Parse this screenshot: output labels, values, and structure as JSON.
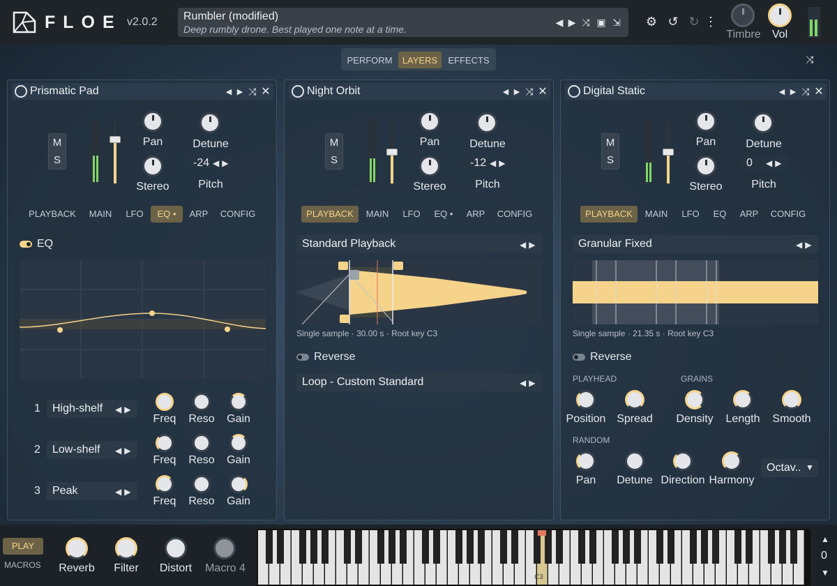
{
  "header": {
    "logo_text": "FLOE",
    "version": "v2.0.2",
    "preset_name": "Rumbler (modified)",
    "preset_description": "Deep rumbly drone. Best played one note at a time.",
    "timbre_label": "Timbre",
    "vol_label": "Vol"
  },
  "main_tabs": [
    {
      "label": "PERFORM"
    },
    {
      "label": "LAYERS"
    },
    {
      "label": "EFFECTS"
    }
  ],
  "layers": [
    {
      "name": "Prismatic Pad",
      "mute": "M",
      "solo": "S",
      "pan_label": "Pan",
      "stereo_label": "Stereo",
      "detune_label": "Detune",
      "pitch_label": "Pitch",
      "pitch_value": "-24",
      "level": 0.85,
      "sub_tabs": [
        "PLAYBACK",
        "MAIN",
        "LFO",
        "EQ •",
        "ARP",
        "CONFIG"
      ],
      "active_sub_tab": "EQ •"
    },
    {
      "name": "Night Orbit",
      "mute": "M",
      "solo": "S",
      "pan_label": "Pan",
      "stereo_label": "Stereo",
      "detune_label": "Detune",
      "pitch_label": "Pitch",
      "pitch_value": "-12",
      "level": 0.5,
      "sub_tabs": [
        "PLAYBACK",
        "MAIN",
        "LFO",
        "EQ •",
        "ARP",
        "CONFIG"
      ],
      "active_sub_tab": "PLAYBACK"
    },
    {
      "name": "Digital Static",
      "mute": "M",
      "solo": "S",
      "pan_label": "Pan",
      "stereo_label": "Stereo",
      "detune_label": "Detune",
      "pitch_label": "Pitch",
      "pitch_value": "0",
      "level": 0.5,
      "sub_tabs": [
        "PLAYBACK",
        "MAIN",
        "LFO",
        "EQ",
        "ARP",
        "CONFIG"
      ],
      "active_sub_tab": "PLAYBACK"
    }
  ],
  "eq": {
    "toggle_label": "EQ",
    "bands": [
      {
        "num": "1",
        "type": "High-shelf"
      },
      {
        "num": "2",
        "type": "Low-shelf"
      },
      {
        "num": "3",
        "type": "Peak"
      }
    ],
    "knob_labels": [
      "Freq",
      "Reso",
      "Gain"
    ]
  },
  "night_orbit": {
    "playback_mode": "Standard Playback",
    "sample_info": [
      "Single sample",
      "30.00 s",
      "Root key C3"
    ],
    "reverse_label": "Reverse",
    "loop_mode": "Loop - Custom Standard"
  },
  "digital_static": {
    "playback_mode": "Granular Fixed",
    "sample_info": [
      "Single sample",
      "21.35 s",
      "Root key C3"
    ],
    "reverse_label": "Reverse",
    "playhead_heading": "PLAYHEAD",
    "grains_heading": "GRAINS",
    "random_heading": "RANDOM",
    "playhead_knobs": [
      "Position",
      "Spread"
    ],
    "grain_knobs": [
      "Density",
      "Length",
      "Smooth"
    ],
    "random_knobs": [
      "Pan",
      "Detune",
      "Direction",
      "Harmony"
    ],
    "octave_value": "Octav.."
  },
  "footer": {
    "play_label": "PLAY",
    "macros_label": "MACROS",
    "macros": [
      "Reverb",
      "Filter",
      "Distort",
      "Macro 4"
    ],
    "key_label": "C3",
    "octave_shift": "0"
  }
}
